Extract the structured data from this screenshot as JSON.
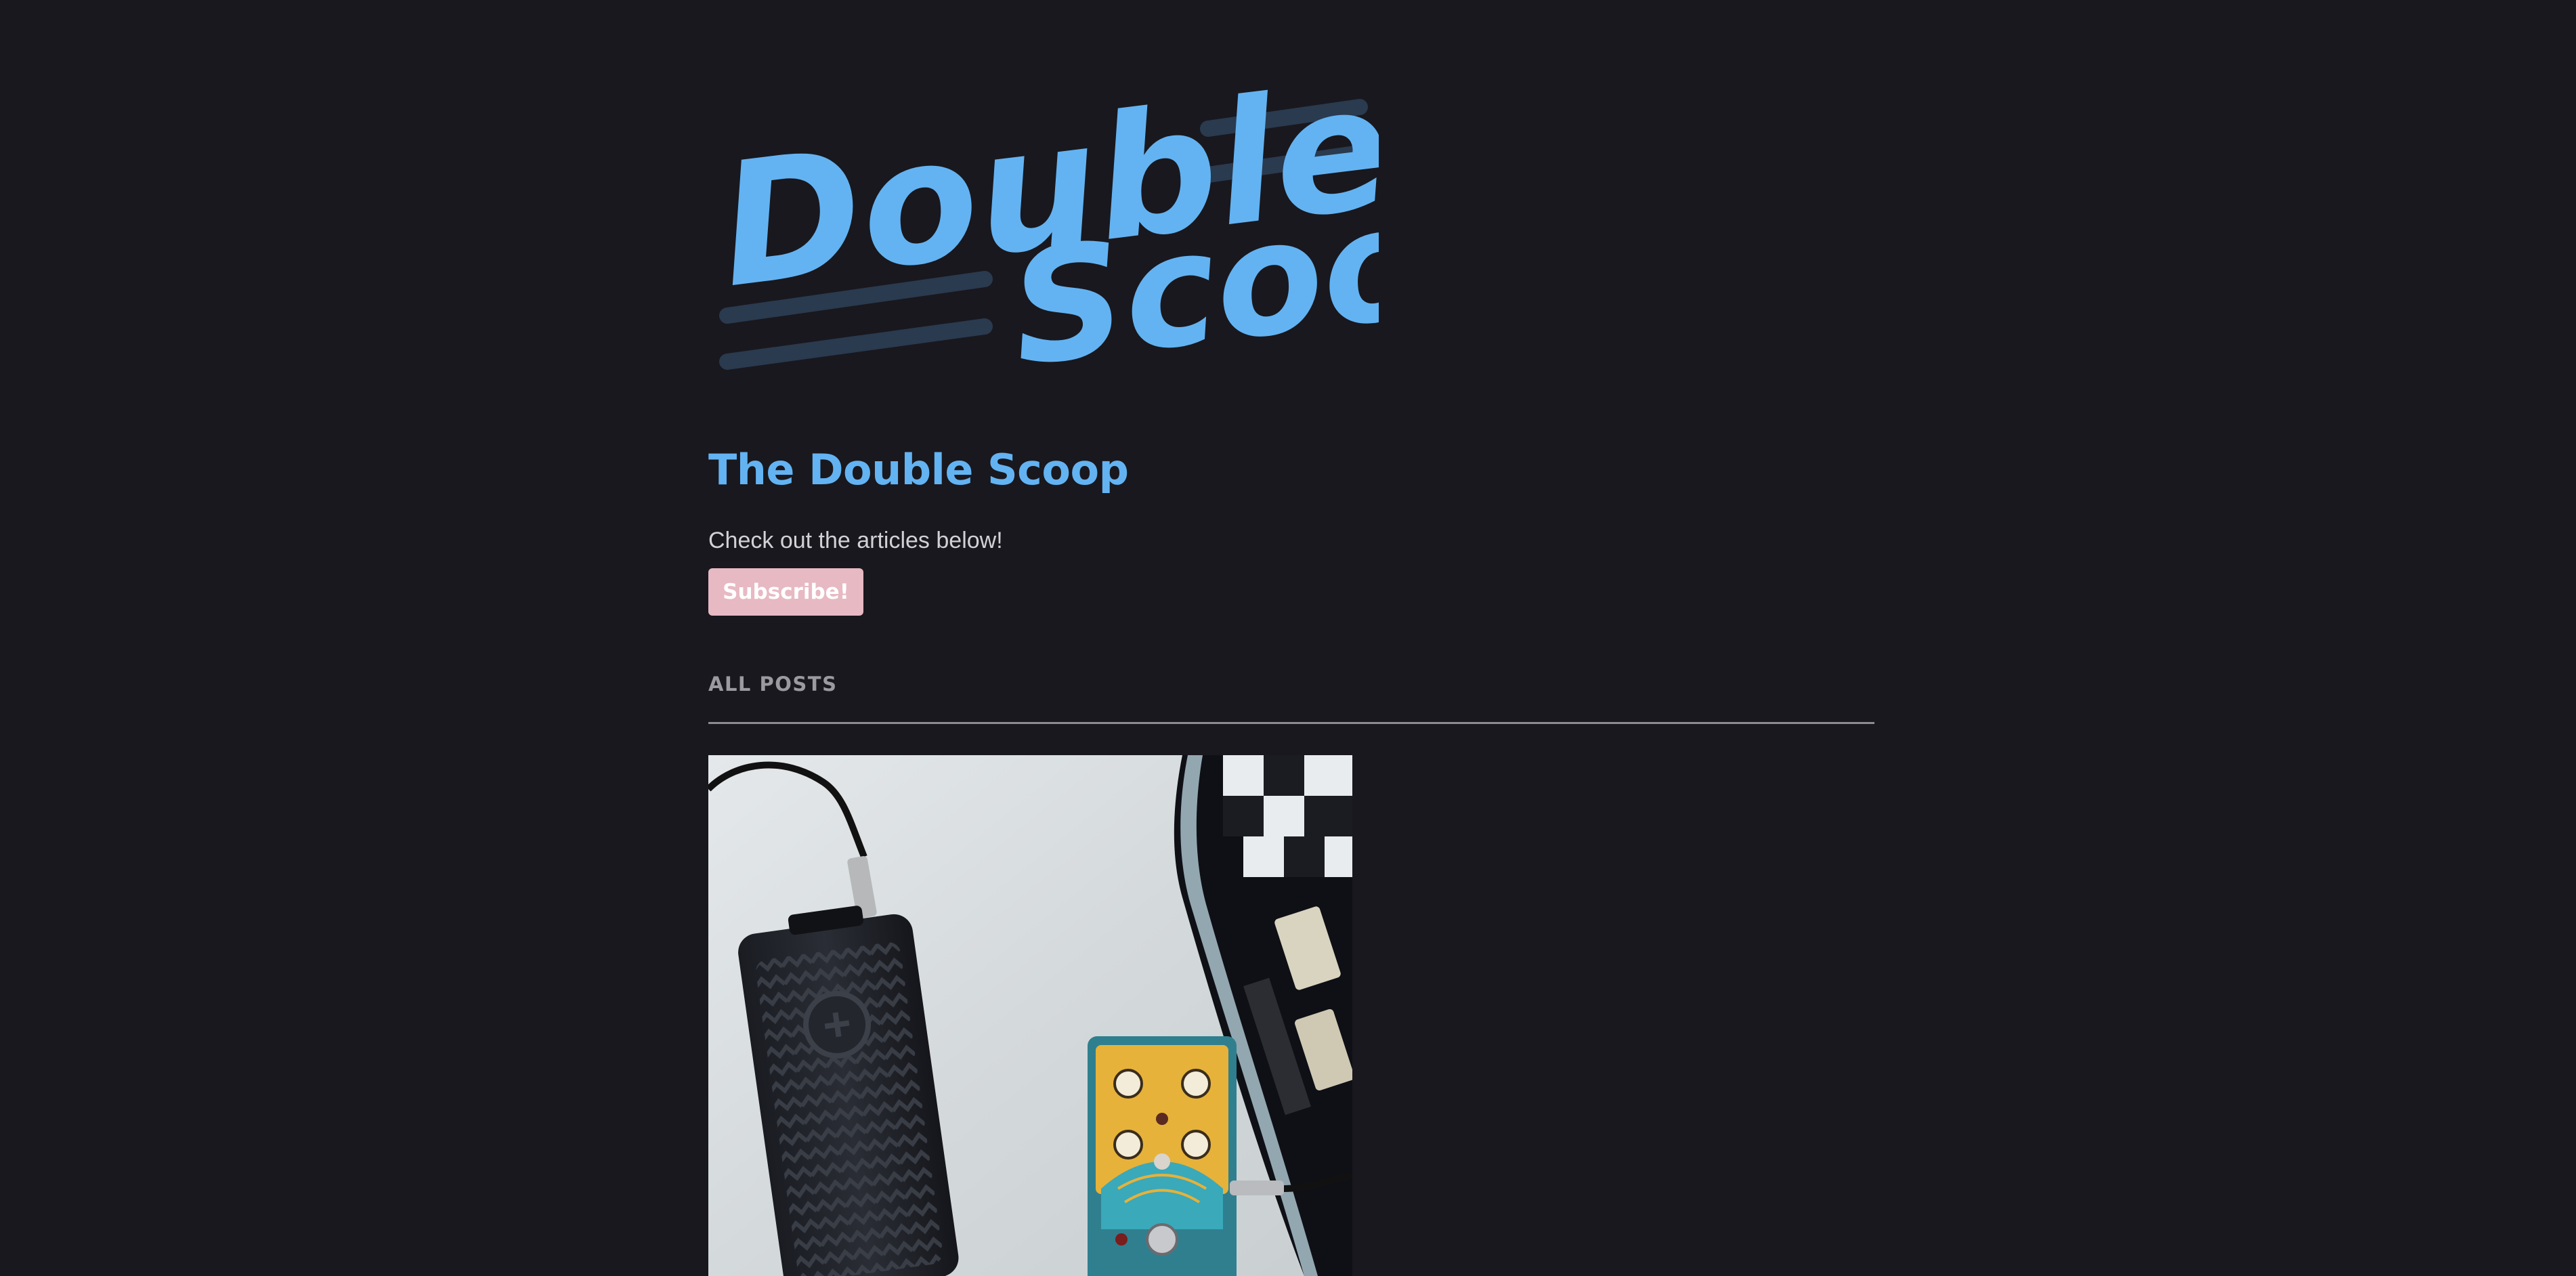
{
  "logo": {
    "line1": "Double",
    "line2": "Scoop"
  },
  "publication": {
    "title": "The Double Scoop",
    "tagline": "Check out the articles below!",
    "subscribe_label": "Subscribe!"
  },
  "posts": {
    "section_label": "ALL POSTS",
    "items": [
      {
        "image": "photo of guitar effects pedals"
      }
    ]
  },
  "colors": {
    "background": "#19181e",
    "accent_blue": "#63b3f2",
    "logo_lines": "#2a3a4f",
    "subscribe_button": "#e7b9c3",
    "section_label": "#9a9aa0",
    "divider": "#8c8b91"
  }
}
